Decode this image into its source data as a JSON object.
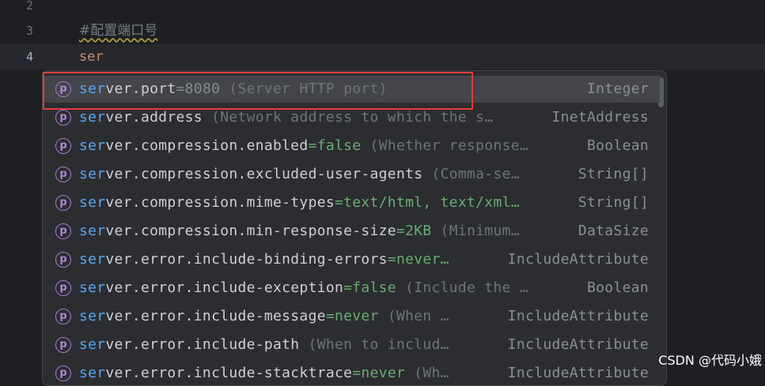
{
  "editor": {
    "lines": [
      {
        "number": "2",
        "text": ""
      },
      {
        "number": "3",
        "text": "#配置端口号"
      },
      {
        "number": "4",
        "text": "ser"
      }
    ]
  },
  "completion": {
    "typed_prefix": "ser",
    "items": [
      {
        "icon": "p",
        "match": "ser",
        "rest": "ver.port",
        "default": "=8080",
        "desc": " (Server HTTP port)",
        "type": "Integer",
        "selected": true
      },
      {
        "icon": "p",
        "match": "ser",
        "rest": "ver.address",
        "default": "",
        "desc": " (Network address to which the s…",
        "type": "InetAddress"
      },
      {
        "icon": "p",
        "match": "ser",
        "rest": "ver.compression.enabled",
        "default": "=false",
        "desc": " (Whether response…",
        "type": "Boolean"
      },
      {
        "icon": "p",
        "match": "ser",
        "rest": "ver.compression.excluded-user-agents",
        "default": "",
        "desc": " (Comma-se…",
        "type": "String[]"
      },
      {
        "icon": "p",
        "match": "ser",
        "rest": "ver.compression.mime-types",
        "default": "=text/html, text/xml…",
        "desc": "",
        "type": "String[]"
      },
      {
        "icon": "p",
        "match": "ser",
        "rest": "ver.compression.min-response-size",
        "default": "=2KB",
        "desc": " (Minimum…",
        "type": "DataSize"
      },
      {
        "icon": "p",
        "match": "ser",
        "rest": "ver.error.include-binding-errors",
        "default": "=never…",
        "desc": "",
        "type": "IncludeAttribute"
      },
      {
        "icon": "p",
        "match": "ser",
        "rest": "ver.error.include-exception",
        "default": "=false",
        "desc": " (Include the …",
        "type": "Boolean"
      },
      {
        "icon": "p",
        "match": "ser",
        "rest": "ver.error.include-message",
        "default": "=never",
        "desc": " (When …",
        "type": "IncludeAttribute"
      },
      {
        "icon": "p",
        "match": "ser",
        "rest": "ver.error.include-path",
        "default": "",
        "desc": " (When to includ…",
        "type": "IncludeAttribute"
      },
      {
        "icon": "p",
        "match": "ser",
        "rest": "ver.error.include-stacktrace",
        "default": "=never",
        "desc": " (Wh…",
        "type": "IncludeAttribute"
      }
    ]
  },
  "watermark": "CSDN @代码小娥"
}
